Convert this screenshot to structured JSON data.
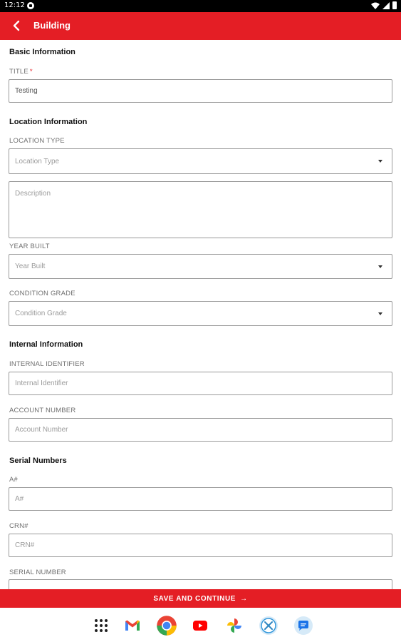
{
  "status_bar": {
    "time": "12:12"
  },
  "app_bar": {
    "title": "Building"
  },
  "sections": {
    "basic": "Basic Information",
    "location": "Location Information",
    "internal": "Internal Information",
    "serial": "Serial Numbers"
  },
  "fields": {
    "title": {
      "label": "TITLE",
      "required": "*",
      "value": "Testing"
    },
    "location_type": {
      "label": "LOCATION TYPE",
      "placeholder": "Location Type"
    },
    "description": {
      "placeholder": "Description"
    },
    "year_built": {
      "label": "YEAR BUILT",
      "placeholder": "Year Built"
    },
    "condition_grade": {
      "label": "CONDITION GRADE",
      "placeholder": "Condition Grade"
    },
    "internal_identifier": {
      "label": "INTERNAL IDENTIFIER",
      "placeholder": "Internal Identifier"
    },
    "account_number": {
      "label": "ACCOUNT NUMBER",
      "placeholder": "Account Number"
    },
    "a_number": {
      "label": "A#",
      "placeholder": "A#"
    },
    "crn_number": {
      "label": "CRN#",
      "placeholder": "CRN#"
    },
    "serial_number": {
      "label": "SERIAL NUMBER"
    }
  },
  "save_bar": {
    "label": "SAVE AND CONTINUE",
    "arrow": "→"
  },
  "colors": {
    "accent": "#e41e25"
  },
  "dock_icons": [
    "app-drawer-icon",
    "gmail-icon",
    "chrome-icon",
    "youtube-icon",
    "photos-icon",
    "app-icon",
    "messages-icon"
  ]
}
